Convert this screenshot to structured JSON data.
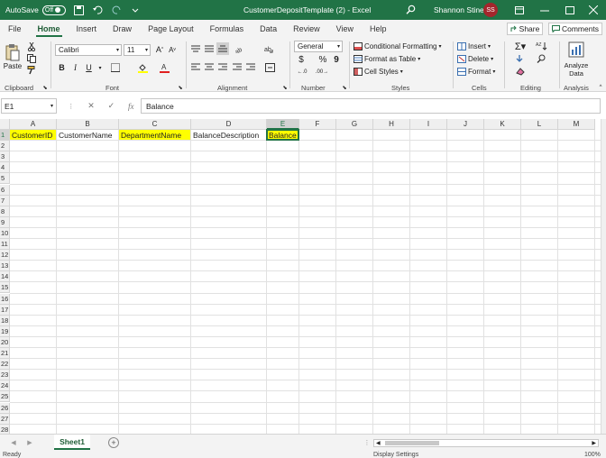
{
  "titlebar": {
    "autosave_label": "AutoSave",
    "autosave_state": "Off",
    "document_title": "CustomerDepositTemplate (2)  -  Excel",
    "user_name": "Shannon Stine",
    "user_initials": "SS",
    "accent_color": "#217346"
  },
  "ribbon_tabs": [
    "File",
    "Home",
    "Insert",
    "Draw",
    "Page Layout",
    "Formulas",
    "Data",
    "Review",
    "View",
    "Help"
  ],
  "active_tab": "Home",
  "share_label": "Share",
  "comments_label": "Comments",
  "ribbon": {
    "clipboard": {
      "paste_label": "Paste",
      "group_label": "Clipboard"
    },
    "font": {
      "font_name": "Calibri",
      "font_size": "11",
      "group_label": "Font"
    },
    "alignment": {
      "group_label": "Alignment"
    },
    "number": {
      "format": "General",
      "group_label": "Number"
    },
    "styles": {
      "conditional": "Conditional Formatting",
      "format_table": "Format as Table",
      "cell_styles": "Cell Styles",
      "group_label": "Styles"
    },
    "cells": {
      "insert": "Insert",
      "delete": "Delete",
      "format": "Format",
      "group_label": "Cells"
    },
    "editing": {
      "group_label": "Editing"
    },
    "analysis": {
      "analyze_line1": "Analyze",
      "analyze_line2": "Data",
      "group_label": "Analysis"
    }
  },
  "formula_bar": {
    "name_box": "E1",
    "fx": "fx",
    "content": "Balance"
  },
  "columns": [
    "A",
    "B",
    "C",
    "D",
    "E",
    "F",
    "G",
    "H",
    "I",
    "J",
    "K",
    "L",
    "M"
  ],
  "rows": [
    "1",
    "2",
    "3",
    "4",
    "5",
    "6",
    "7",
    "8",
    "9",
    "10",
    "11",
    "12",
    "13",
    "14",
    "15",
    "16",
    "17",
    "18",
    "19",
    "20",
    "21",
    "22",
    "23",
    "24",
    "25",
    "26",
    "27",
    "28"
  ],
  "cells": {
    "A1": "CustomerID",
    "B1": "CustomerName",
    "C1": "DepartmentName",
    "D1": "BalanceDescription",
    "E1": "Balance"
  },
  "highlight_color": "#ffff00",
  "sheet_tab": "Sheet1",
  "status": {
    "ready": "Ready",
    "display_settings": "Display Settings",
    "zoom": "100%"
  }
}
